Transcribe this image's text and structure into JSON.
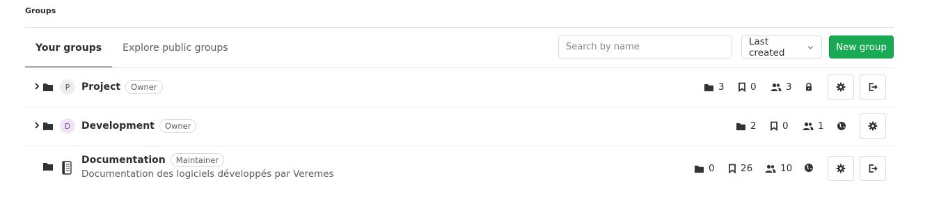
{
  "breadcrumb": "Groups",
  "tabs": [
    {
      "label": "Your groups",
      "active": true
    },
    {
      "label": "Explore public groups",
      "active": false
    }
  ],
  "search": {
    "placeholder": "Search by name",
    "value": ""
  },
  "sort": {
    "label": "Last created"
  },
  "new_group_label": "New group",
  "accent_color": "#1aaa55",
  "groups": [
    {
      "name": "Project",
      "avatar_letter": "P",
      "role": "Owner",
      "expandable": true,
      "subgroups": "3",
      "projects": "0",
      "members": "3",
      "visibility": "private",
      "actions": [
        "settings",
        "leave"
      ]
    },
    {
      "name": "Development",
      "avatar_letter": "D",
      "role": "Owner",
      "expandable": true,
      "subgroups": "2",
      "projects": "0",
      "members": "1",
      "visibility": "public",
      "actions": [
        "settings"
      ]
    },
    {
      "name": "Documentation",
      "avatar_icon": "book-icon",
      "role": "Maintainer",
      "description": "Documentation des logiciels développés par Veremes",
      "expandable": false,
      "subgroups": "0",
      "projects": "26",
      "members": "10",
      "visibility": "public",
      "actions": [
        "settings",
        "leave"
      ]
    }
  ]
}
